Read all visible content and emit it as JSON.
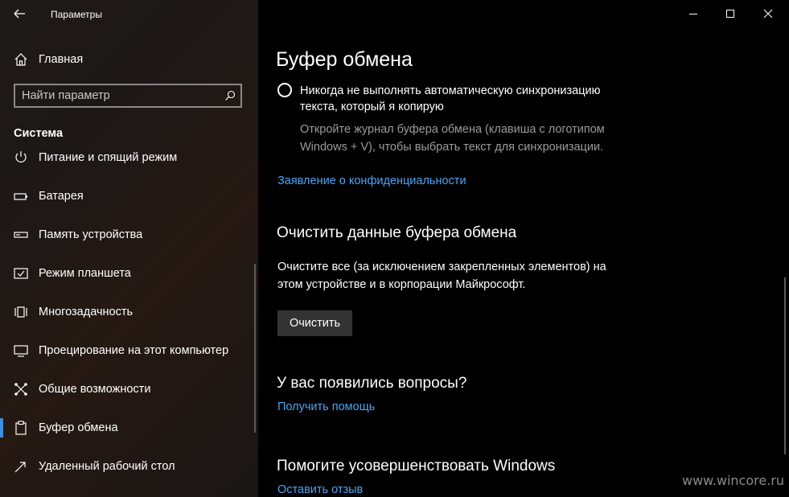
{
  "window": {
    "title": "Параметры",
    "controls": [
      "minimize",
      "maximize",
      "close"
    ]
  },
  "sidebar": {
    "home_label": "Главная",
    "search_placeholder": "Найти параметр",
    "section_title": "Система",
    "items": [
      {
        "label": "Питание и спящий режим",
        "icon": "power-icon"
      },
      {
        "label": "Батарея",
        "icon": "battery-icon"
      },
      {
        "label": "Память устройства",
        "icon": "storage-icon"
      },
      {
        "label": "Режим планшета",
        "icon": "tablet-icon"
      },
      {
        "label": "Многозадачность",
        "icon": "multitasking-icon"
      },
      {
        "label": "Проецирование на этот компьютер",
        "icon": "projecting-icon"
      },
      {
        "label": "Общие возможности",
        "icon": "shared-experiences-icon"
      },
      {
        "label": "Буфер обмена",
        "icon": "clipboard-icon",
        "selected": true
      },
      {
        "label": "Удаленный рабочий стол",
        "icon": "remote-desktop-icon"
      }
    ]
  },
  "content": {
    "page_title": "Буфер обмена",
    "sync_option": {
      "label": "Никогда не выполнять автоматическую синхронизацию текста, который я копирую",
      "description": "Откройте журнал буфера обмена (клавиша с логотипом Windows + V), чтобы выбрать текст для синхронизации."
    },
    "privacy_link": "Заявление о конфиденциальности",
    "clear_section": {
      "heading": "Очистить данные буфера обмена",
      "text": "Очистите все (за исключением закрепленных элементов) на этом устройстве и в корпорации Майкрософт.",
      "button_label": "Очистить"
    },
    "questions_section": {
      "heading": "У вас появились вопросы?",
      "link": "Получить помощь"
    },
    "improve_section": {
      "heading": "Помогите усовершенствовать Windows",
      "link": "Оставить отзыв"
    }
  },
  "watermark": "www.wincore.ru",
  "colors": {
    "accent": "#3d8fe0",
    "link": "#4da3f4",
    "muted_text": "#9b9b9b",
    "button_bg": "#333333"
  }
}
